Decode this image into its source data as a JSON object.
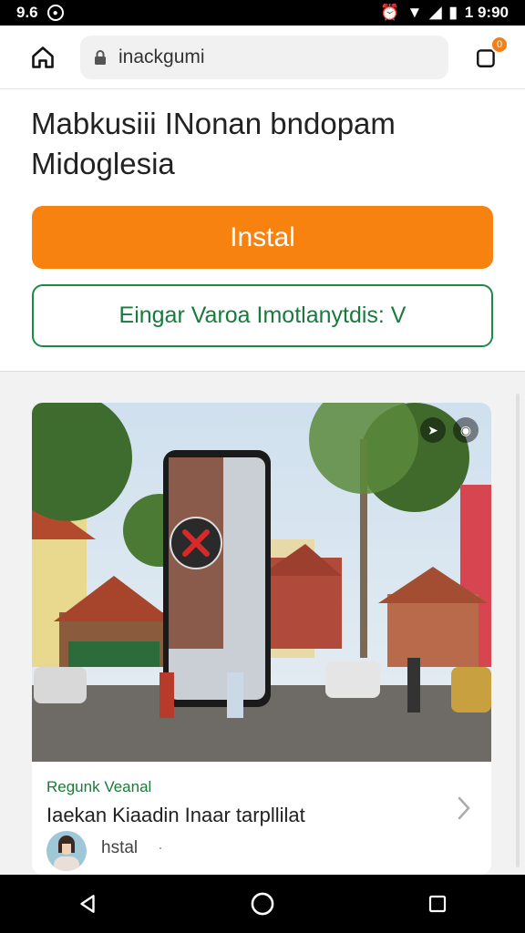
{
  "status_bar": {
    "left_time": "9.6",
    "right_time": "1 9:90"
  },
  "browser": {
    "url": "inackgumi",
    "tab_count": "0"
  },
  "page": {
    "title": "Mabkusiii INonan bndopam Midoglesia",
    "install_label": "Instal",
    "secondary_label": "Eingar Varoa Imotlanytdis: V"
  },
  "card": {
    "kicker": "Regunk Veanal",
    "title": "Iaekan Kiaadin Inaar tarpllilat",
    "author": "hstal",
    "verified": "·"
  },
  "colors": {
    "accent": "#f7820f",
    "green": "#1c8a45"
  },
  "icons": [
    "home-icon",
    "lock-icon",
    "tabs-icon",
    "chevron-right-icon",
    "back-icon",
    "home-circle-icon",
    "recents-icon"
  ]
}
